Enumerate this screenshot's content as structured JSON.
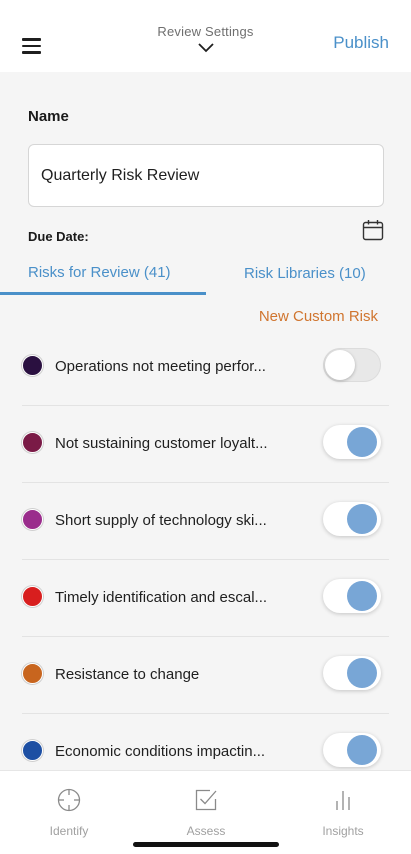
{
  "header": {
    "title": "Review Settings",
    "publish_label": "Publish"
  },
  "form": {
    "name_label": "Name",
    "name_value": "Quarterly Risk Review",
    "due_date_label": "Due Date:"
  },
  "tabs": {
    "risks_for_review": "Risks for Review (41)",
    "risk_libraries": "Risk Libraries (10)",
    "active": "risks_for_review"
  },
  "new_custom_risk_label": "New Custom Risk",
  "risks": [
    {
      "label": "Operations not meeting perfor...",
      "color": "#2a1040",
      "enabled": false
    },
    {
      "label": "Not sustaining customer loyalt...",
      "color": "#7a1a46",
      "enabled": true
    },
    {
      "label": "Short supply of technology ski...",
      "color": "#9a2c8c",
      "enabled": true
    },
    {
      "label": "Timely identification and escal...",
      "color": "#d81e1e",
      "enabled": true
    },
    {
      "label": "Resistance to change",
      "color": "#c8651e",
      "enabled": true
    },
    {
      "label": "Economic conditions impactin...",
      "color": "#1d4fa3",
      "enabled": true
    }
  ],
  "bottom_nav": {
    "identify": {
      "label": "Identify",
      "icon": "crosshair-icon"
    },
    "assess": {
      "label": "Assess",
      "icon": "checkbox-icon"
    },
    "insights": {
      "label": "Insights",
      "icon": "bar-chart-icon"
    }
  },
  "colors": {
    "accent_blue": "#4a90c9",
    "accent_orange": "#d0752f",
    "toggle_on": "#78a6d6"
  }
}
